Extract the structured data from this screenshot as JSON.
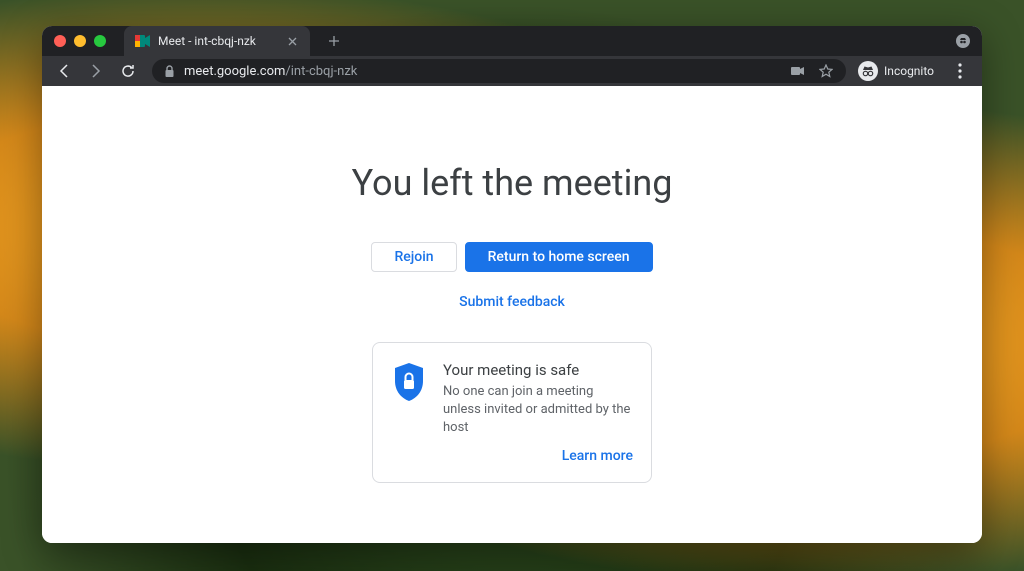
{
  "browser": {
    "tab": {
      "title": "Meet - int-cbqj-nzk"
    },
    "url": {
      "domain": "meet.google.com",
      "path": "/int-cbqj-nzk"
    },
    "profile_label": "Incognito"
  },
  "page": {
    "title": "You left the meeting",
    "buttons": {
      "rejoin": "Rejoin",
      "return_home": "Return to home screen"
    },
    "feedback_link": "Submit feedback",
    "safety_card": {
      "title": "Your meeting is safe",
      "description": "No one can join a meeting unless invited or admitted by the host",
      "learn_more": "Learn more"
    }
  }
}
